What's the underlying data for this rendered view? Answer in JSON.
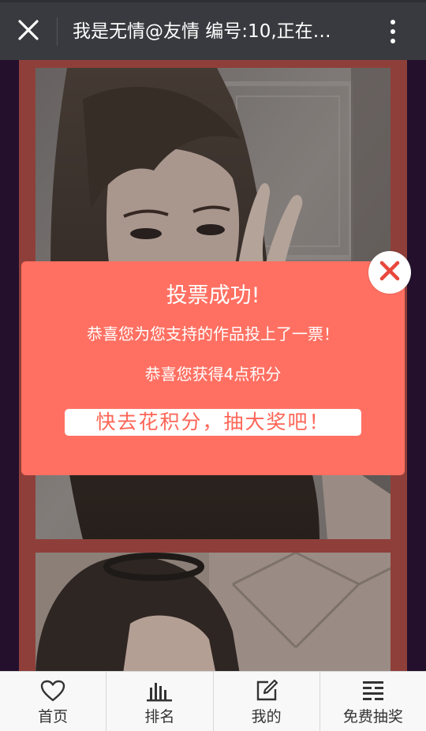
{
  "header": {
    "title": "我是无情@友情 编号:10,正在…",
    "close_icon": "close-icon",
    "more_icon": "more-vertical-icon"
  },
  "modal": {
    "title": "投票成功!",
    "message": "恭喜您为您支持的作品投上了一票！",
    "points_message": "恭喜您获得4点积分",
    "cta_label": "快去花积分，抽大奖吧！",
    "close_icon": "close-x-icon",
    "colors": {
      "background": "#ff7062",
      "close_x": "#e8483c"
    }
  },
  "tabbar": {
    "items": [
      {
        "label": "首页",
        "icon": "heart-icon"
      },
      {
        "label": "排名",
        "icon": "bar-chart-icon"
      },
      {
        "label": "我的",
        "icon": "edit-icon"
      },
      {
        "label": "免费抽奖",
        "icon": "lottery-icon"
      }
    ]
  },
  "colors": {
    "topbar": "#393a3f",
    "page_background": "#24102c",
    "photo_frame": "#8f3f3a"
  }
}
